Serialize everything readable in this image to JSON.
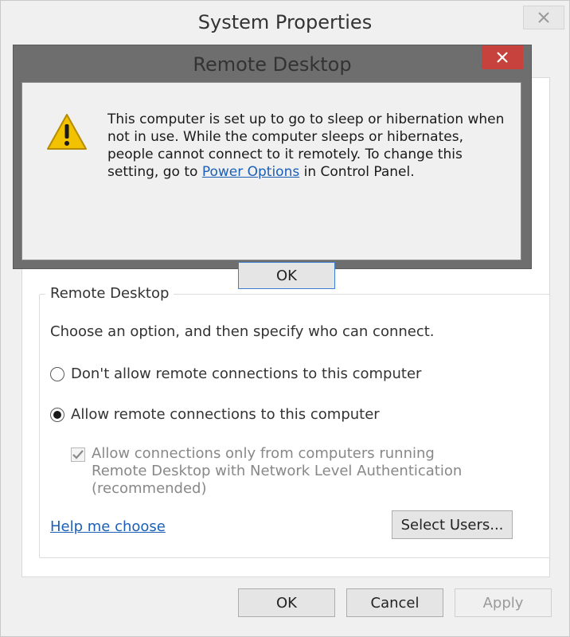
{
  "system_properties": {
    "title": "System Properties",
    "remote_desktop_group": {
      "legend": "Remote Desktop",
      "instruction": "Choose an option, and then specify who can connect.",
      "options": [
        {
          "label": "Don't allow remote connections to this computer",
          "selected": false
        },
        {
          "label": "Allow remote connections to this computer",
          "selected": true
        }
      ],
      "nla_checkbox": {
        "label": "Allow connections only from computers running Remote Desktop with Network Level Authentication (recommended)",
        "checked": true,
        "enabled": false
      },
      "help_link": "Help me choose",
      "select_users_button": "Select Users..."
    },
    "footer_buttons": {
      "ok": "OK",
      "cancel": "Cancel",
      "apply": "Apply"
    }
  },
  "remote_desktop_dialog": {
    "title": "Remote Desktop",
    "message_part1": "This computer is set up to go to sleep or hibernation when not in use. While the computer sleeps or hibernates, people cannot connect to it remotely. To change this setting, go to ",
    "message_link": "Power Options",
    "message_part2": " in Control Panel.",
    "ok_button": "OK",
    "icon": "warning-icon"
  },
  "colors": {
    "close_button_red": "#c7423c",
    "link_blue": "#1b5fb6",
    "warning_yellow": "#f2c200"
  }
}
